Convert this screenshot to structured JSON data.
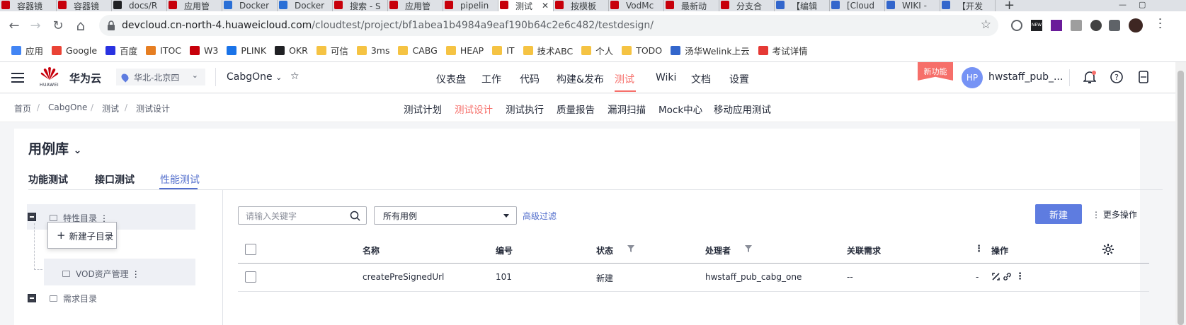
{
  "browser": {
    "tabs": [
      {
        "label": "容器镜",
        "color": "#c7000b"
      },
      {
        "label": "容器镜",
        "color": "#c7000b"
      },
      {
        "label": "docs/R",
        "color": "#202124"
      },
      {
        "label": "应用管",
        "color": "#c7000b"
      },
      {
        "label": "Docker",
        "color": "#2a6fd6"
      },
      {
        "label": "Docker",
        "color": "#2a6fd6"
      },
      {
        "label": "搜索 - S",
        "color": "#c7000b"
      },
      {
        "label": "应用管",
        "color": "#c7000b"
      },
      {
        "label": "pipelin",
        "color": "#c7000b"
      },
      {
        "label": "测试",
        "color": "#c7000b",
        "active": true
      },
      {
        "label": "按模板",
        "color": "#c7000b"
      },
      {
        "label": "VodMc",
        "color": "#c7000b"
      },
      {
        "label": "最新动",
        "color": "#c7000b"
      },
      {
        "label": "分支合",
        "color": "#c7000b"
      },
      {
        "label": "【编辑",
        "color": "#3366cc"
      },
      {
        "label": "[Cloud",
        "color": "#3366cc"
      },
      {
        "label": "WIKI -",
        "color": "#3366cc"
      },
      {
        "label": "【开发",
        "color": "#3366cc"
      }
    ],
    "new_tab_glyph": "+",
    "close_tab_glyph": "✕",
    "url_host": "devcloud.cn-north-4.huaweicloud.com",
    "url_path": "/cloudtest/project/bf1abea1b4984a9eaf190b64c2e6c482/testdesign/",
    "back_glyph": "←",
    "forward_glyph": "→",
    "reload_glyph": "↻",
    "home_glyph": "⌂",
    "star_glyph": "☆",
    "bookmarks": [
      {
        "label": "应用",
        "icon": "apps-icon",
        "color": "#4285f4"
      },
      {
        "label": "Google",
        "icon": "google-icon",
        "color": "#ea4335"
      },
      {
        "label": "百度",
        "icon": "baidu-icon",
        "color": "#2932e1"
      },
      {
        "label": "ITOC",
        "icon": "itoc-icon",
        "color": "#e67e22"
      },
      {
        "label": "W3",
        "icon": "w3-icon",
        "color": "#c7000b"
      },
      {
        "label": "PLINK",
        "icon": "plink-icon",
        "color": "#1a73e8"
      },
      {
        "label": "OKR",
        "icon": "okr-icon",
        "color": "#202124"
      },
      {
        "label": "可信",
        "icon": "folder-icon",
        "color": "#f5c343"
      },
      {
        "label": "3ms",
        "icon": "folder-icon",
        "color": "#f5c343"
      },
      {
        "label": "CABG",
        "icon": "folder-icon",
        "color": "#f5c343"
      },
      {
        "label": "HEAP",
        "icon": "folder-icon",
        "color": "#f5c343"
      },
      {
        "label": "IT",
        "icon": "folder-icon",
        "color": "#f5c343"
      },
      {
        "label": "技术ABC",
        "icon": "folder-icon",
        "color": "#f5c343"
      },
      {
        "label": "个人",
        "icon": "folder-icon",
        "color": "#f5c343"
      },
      {
        "label": "TODO",
        "icon": "folder-icon",
        "color": "#f5c343"
      },
      {
        "label": "汤华Welink上云",
        "icon": "welink-icon",
        "color": "#3366cc"
      },
      {
        "label": "考试详情",
        "icon": "exam-icon",
        "color": "#e53935"
      }
    ]
  },
  "app": {
    "brand": "华为云",
    "logo_text": "HUAWEI",
    "region": "华北-北京四",
    "project": "CabgOne",
    "nav": [
      {
        "label": "仪表盘"
      },
      {
        "label": "工作"
      },
      {
        "label": "代码"
      },
      {
        "label": "构建&发布"
      },
      {
        "label": "测试",
        "active": true
      },
      {
        "label": "Wiki"
      },
      {
        "label": "文档"
      },
      {
        "label": "设置"
      }
    ],
    "new_feature_badge": "新功能",
    "avatar_initials": "HP",
    "username": "hwstaff_pub_...",
    "accent_color": "#f66f6a",
    "primary_color": "#5e7ce0"
  },
  "breadcrumb": [
    "首页",
    "CabgOne",
    "测试",
    "测试设计"
  ],
  "breadcrumb_sep": "/",
  "subnav": [
    {
      "label": "测试计划"
    },
    {
      "label": "测试设计",
      "active": true
    },
    {
      "label": "测试执行"
    },
    {
      "label": "质量报告"
    },
    {
      "label": "漏洞扫描"
    },
    {
      "label": "Mock中心"
    },
    {
      "label": "移动应用测试"
    }
  ],
  "library": {
    "title": "用例库",
    "tabs": [
      {
        "label": "功能测试"
      },
      {
        "label": "接口测试"
      },
      {
        "label": "性能测试",
        "active": true
      }
    ],
    "tree": {
      "root_feature": "特性目录",
      "popover_label": "新建子目录",
      "popover_plus": "+",
      "child": "VOD资产管理",
      "root_requirement": "需求目录",
      "more_glyph": "⋮"
    },
    "toolbar": {
      "search_placeholder": "请输入关键字",
      "filter_value": "所有用例",
      "advanced_filter": "高级过滤",
      "new_button": "新建",
      "more_ops": "更多操作"
    },
    "table": {
      "columns": [
        "名称",
        "编号",
        "状态",
        "处理者",
        "关联需求",
        "操作"
      ],
      "rows": [
        {
          "name": "createPreSignedUrl",
          "id": "101",
          "status": "新建",
          "handler": "hwstaff_pub_cabg_one",
          "requirement": "--",
          "trailing": "-"
        }
      ]
    }
  }
}
